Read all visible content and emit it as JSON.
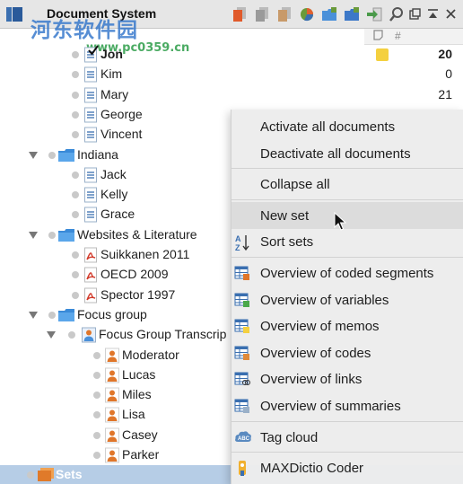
{
  "window": {
    "title": "Document System"
  },
  "watermark": {
    "main": "河东软件园",
    "url": "www.pc0359.cn"
  },
  "toolbar": [
    {
      "name": "new-document-icon",
      "color": "#e05a2b"
    },
    {
      "name": "copy-documents-icon",
      "color": "#9a9a9a"
    },
    {
      "name": "paste-documents-icon",
      "color": "#c89a6a"
    },
    {
      "name": "chart-icon",
      "color": "#e06030"
    },
    {
      "name": "new-folder-icon",
      "color": "#4a90d9"
    },
    {
      "name": "set-icon",
      "color": "#3c78c8"
    },
    {
      "name": "import-icon",
      "color": "#4a9a4a"
    },
    {
      "name": "search-icon",
      "color": "#555555"
    }
  ],
  "columns": {
    "memo": "",
    "count": "#"
  },
  "tree": [
    {
      "label": "Jon",
      "level": 3,
      "icon": "doc",
      "count": "20",
      "bold": true,
      "check": true,
      "memo": true
    },
    {
      "label": "Kim",
      "level": 3,
      "icon": "doc",
      "count": "0"
    },
    {
      "label": "Mary",
      "level": 3,
      "icon": "doc",
      "count": "21"
    },
    {
      "label": "George",
      "level": 3,
      "icon": "doc",
      "count": ""
    },
    {
      "label": "Vincent",
      "level": 3,
      "icon": "doc",
      "count": ""
    },
    {
      "label": "Indiana",
      "level": 1,
      "icon": "folder",
      "count": "",
      "expanded": true
    },
    {
      "label": "Jack",
      "level": 3,
      "icon": "doc",
      "count": ""
    },
    {
      "label": "Kelly",
      "level": 3,
      "icon": "doc",
      "count": ""
    },
    {
      "label": "Grace",
      "level": 3,
      "icon": "doc",
      "count": ""
    },
    {
      "label": "Websites & Literature",
      "level": 1,
      "icon": "folder",
      "count": "",
      "expanded": true
    },
    {
      "label": "Suikkanen 2011",
      "level": 3,
      "icon": "pdf",
      "count": ""
    },
    {
      "label": "OECD 2009",
      "level": 3,
      "icon": "pdf",
      "count": ""
    },
    {
      "label": "Spector 1997",
      "level": 3,
      "icon": "pdf",
      "count": ""
    },
    {
      "label": "Focus group",
      "level": 1,
      "icon": "folder",
      "count": "",
      "expanded": true
    },
    {
      "label": "Focus Group Transcrip",
      "level": 2,
      "icon": "group",
      "count": "",
      "expanded": true
    },
    {
      "label": "Moderator",
      "level": 4,
      "icon": "person",
      "count": ""
    },
    {
      "label": "Lucas",
      "level": 4,
      "icon": "person",
      "count": ""
    },
    {
      "label": "Miles",
      "level": 4,
      "icon": "person",
      "count": ""
    },
    {
      "label": "Lisa",
      "level": 4,
      "icon": "person",
      "count": ""
    },
    {
      "label": "Casey",
      "level": 4,
      "icon": "person",
      "count": ""
    },
    {
      "label": "Parker",
      "level": 4,
      "icon": "person",
      "count": ""
    },
    {
      "label": "Sets",
      "level": 0,
      "icon": "sets",
      "count": "",
      "selected": true
    }
  ],
  "context_menu": {
    "items": [
      {
        "label": "Activate all documents",
        "icon": ""
      },
      {
        "label": "Deactivate all documents",
        "icon": "",
        "sep_after": true
      },
      {
        "label": "Collapse all",
        "icon": "",
        "sep_after": true
      },
      {
        "label": "New set",
        "icon": "",
        "highlighted": true
      },
      {
        "label": "Sort sets",
        "icon": "sort-az-icon",
        "sep_after": true
      },
      {
        "label": "Overview of coded segments",
        "icon": "coded-segments-table-icon"
      },
      {
        "label": "Overview of variables",
        "icon": "variables-table-icon"
      },
      {
        "label": "Overview of memos",
        "icon": "memos-table-icon"
      },
      {
        "label": "Overview of codes",
        "icon": "codes-table-icon"
      },
      {
        "label": "Overview of links",
        "icon": "links-table-icon"
      },
      {
        "label": "Overview of summaries",
        "icon": "summaries-table-icon",
        "sep_after": true
      },
      {
        "label": "Tag cloud",
        "icon": "tag-cloud-icon",
        "sep_after": true
      },
      {
        "label": "MAXDictio Coder",
        "icon": "maxdictio-coder-icon"
      }
    ]
  }
}
